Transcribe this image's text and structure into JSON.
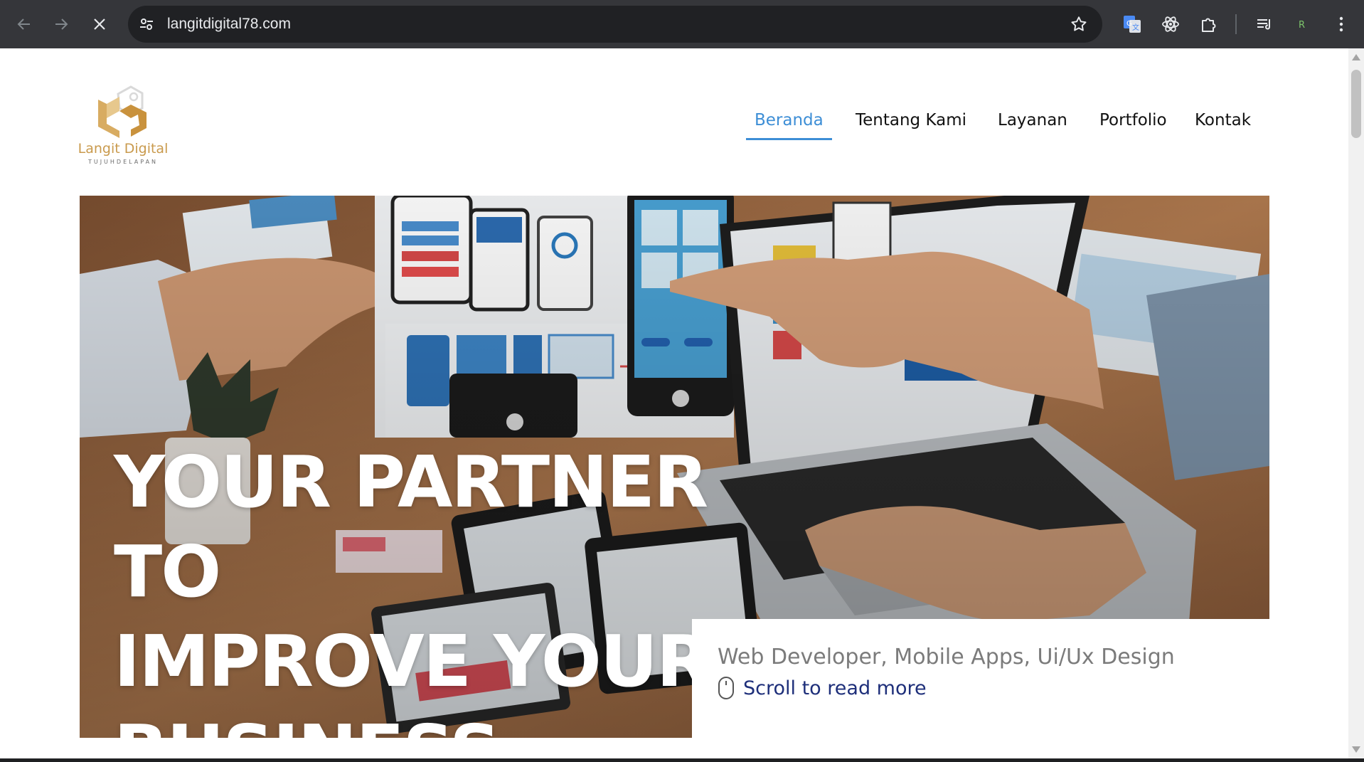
{
  "browser": {
    "url": "langitdigital78.com",
    "icons": [
      "back-arrow-icon",
      "forward-arrow-icon",
      "stop-loading-icon",
      "site-settings-icon",
      "bookmark-star-icon",
      "google-translate-icon",
      "react-devtools-icon",
      "extensions-puzzle-icon",
      "reading-list-icon",
      "profile-icon",
      "more-menu-icon"
    ]
  },
  "site": {
    "logo": {
      "name": "Langit Digital",
      "tagline": "TUJUHDELAPAN"
    },
    "nav": [
      {
        "label": "Beranda",
        "active": true
      },
      {
        "label": "Tentang Kami",
        "active": false
      },
      {
        "label": "Layanan",
        "active": false
      },
      {
        "label": "Portfolio",
        "active": false
      },
      {
        "label": "Kontak",
        "active": false
      }
    ],
    "hero": {
      "title_lines": [
        "YOUR PARTNER TO",
        "IMPROVE YOUR",
        "BUSINESS"
      ],
      "subtitle": "Web Developer, Mobile Apps, Ui/Ux Design",
      "scroll_label": "Scroll to read more"
    }
  },
  "colors": {
    "chrome_bg": "#35363a",
    "omnibox_bg": "#202124",
    "nav_active": "#3d8ed6",
    "logo_gold": "#c99a4d",
    "scroll_link": "#1e2f7a",
    "subtitle_gray": "#7b7b7b"
  }
}
